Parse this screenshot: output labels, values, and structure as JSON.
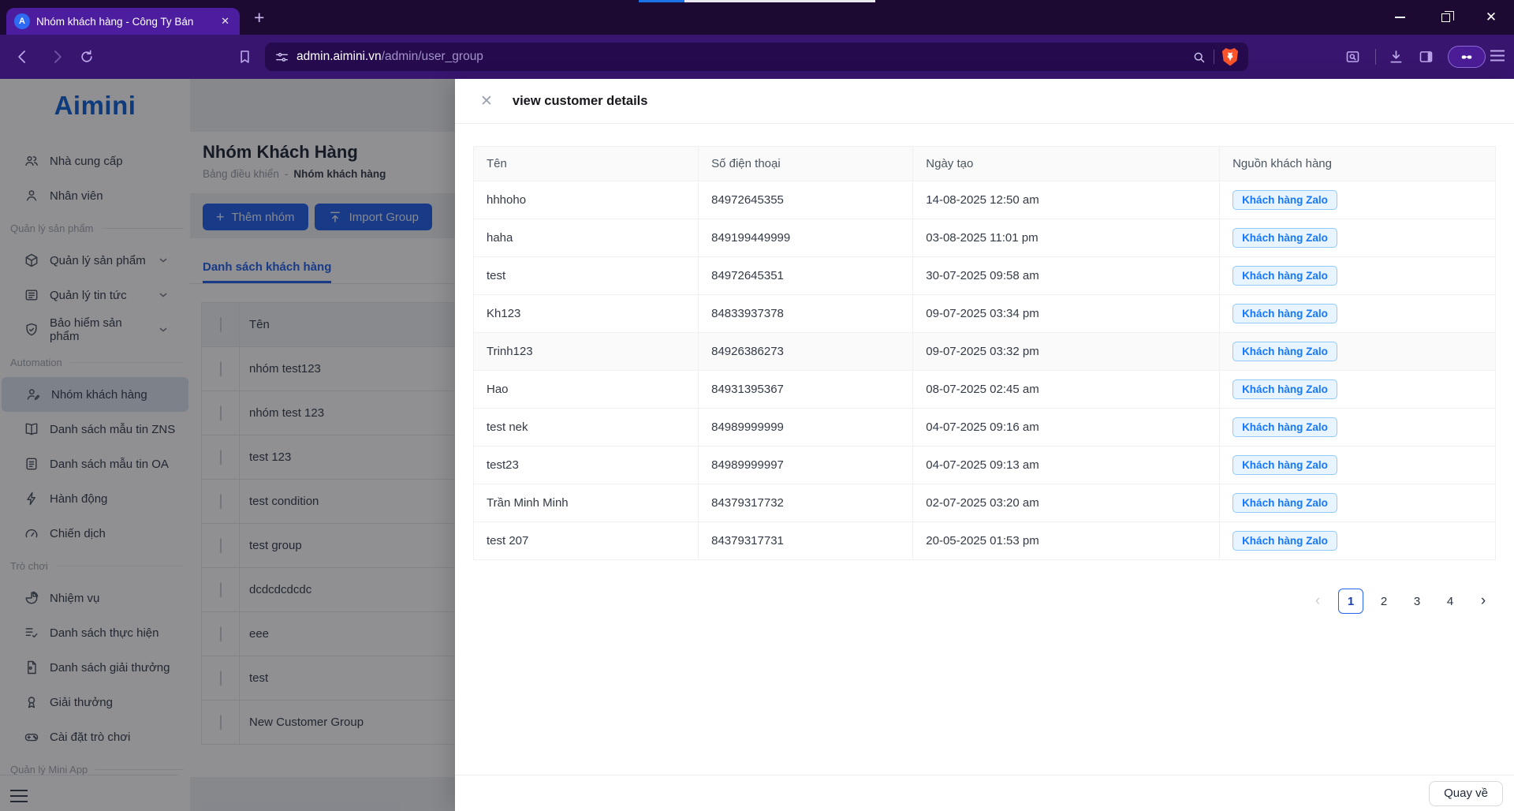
{
  "browser": {
    "tab": {
      "title": "Nhóm khách hàng - Công Ty Bán",
      "favicon_letter": "A"
    },
    "url": {
      "host": "admin.aimini.vn",
      "path": "/admin/user_group"
    }
  },
  "sidebar": {
    "logo": "Aimini",
    "nav": [
      {
        "kind": "item",
        "icon": "users",
        "label": "Nhà cung cấp"
      },
      {
        "kind": "item",
        "icon": "user",
        "label": "Nhân viên"
      },
      {
        "kind": "section",
        "label": "Quản lý sản phẩm"
      },
      {
        "kind": "item",
        "icon": "cube",
        "label": "Quản lý sản phẩm",
        "chevron": true
      },
      {
        "kind": "item",
        "icon": "news",
        "label": "Quản lý tin tức",
        "chevron": true
      },
      {
        "kind": "item",
        "icon": "shield",
        "label": "Bảo hiểm sản phẩm",
        "chevron": true
      },
      {
        "kind": "section",
        "label": "Automation"
      },
      {
        "kind": "item",
        "icon": "user-pen",
        "label": "Nhóm khách hàng",
        "active": true
      },
      {
        "kind": "item",
        "icon": "book",
        "label": "Danh sách mẫu tin ZNS"
      },
      {
        "kind": "item",
        "icon": "doc",
        "label": "Danh sách mẫu tin OA"
      },
      {
        "kind": "item",
        "icon": "bolt",
        "label": "Hành động"
      },
      {
        "kind": "item",
        "icon": "gauge",
        "label": "Chiến dịch"
      },
      {
        "kind": "section",
        "label": "Trò chơi"
      },
      {
        "kind": "item",
        "icon": "pie",
        "label": "Nhiệm vụ"
      },
      {
        "kind": "item",
        "icon": "list",
        "label": "Danh sách thực hiện"
      },
      {
        "kind": "item",
        "icon": "file",
        "label": "Danh sách giải thưởng"
      },
      {
        "kind": "item",
        "icon": "medal",
        "label": "Giải thưởng"
      },
      {
        "kind": "item",
        "icon": "gamepad",
        "label": "Cài đặt trò chơi"
      },
      {
        "kind": "section",
        "label": "Quản lý Mini App"
      }
    ]
  },
  "main": {
    "title": "Nhóm Khách Hàng",
    "breadcrumb": {
      "home": "Bảng điều khiển",
      "sep": "-",
      "current": "Nhóm khách hàng"
    },
    "buttons": {
      "add": "Thêm nhóm",
      "import": "Import Group"
    },
    "tab_label": "Danh sách khách hàng",
    "group_table": {
      "name_header": "Tên",
      "rows": [
        "nhóm test123",
        "nhóm test 123",
        "test 123",
        "test condition",
        "test group",
        "dcdcdcdcdc",
        "eee",
        "test",
        "New Customer Group"
      ]
    }
  },
  "modal": {
    "title": "view customer details",
    "table": {
      "columns": [
        "Tên",
        "Số điện thoại",
        "Ngày tạo",
        "Nguồn khách hàng"
      ],
      "rows": [
        {
          "name": "hhhoho",
          "phone": "84972645355",
          "created": "14-08-2025 12:50 am",
          "source": "Khách hàng Zalo"
        },
        {
          "name": "haha",
          "phone": "849199449999",
          "created": "03-08-2025 11:01 pm",
          "source": "Khách hàng Zalo"
        },
        {
          "name": "test",
          "phone": "84972645351",
          "created": "30-07-2025 09:58 am",
          "source": "Khách hàng Zalo"
        },
        {
          "name": "Kh123",
          "phone": "84833937378",
          "created": "09-07-2025 03:34 pm",
          "source": "Khách hàng Zalo"
        },
        {
          "name": "Trinh123",
          "phone": "84926386273",
          "created": "09-07-2025 03:32 pm",
          "source": "Khách hàng Zalo",
          "hover": true
        },
        {
          "name": "Hao",
          "phone": "84931395367",
          "created": "08-07-2025 02:45 am",
          "source": "Khách hàng Zalo"
        },
        {
          "name": "test nek",
          "phone": "84989999999",
          "created": "04-07-2025 09:16 am",
          "source": "Khách hàng Zalo"
        },
        {
          "name": "test23",
          "phone": "84989999997",
          "created": "04-07-2025 09:13 am",
          "source": "Khách hàng Zalo"
        },
        {
          "name": "Trần Minh Minh",
          "phone": "84379317732",
          "created": "02-07-2025 03:20 am",
          "source": "Khách hàng Zalo"
        },
        {
          "name": "test 207",
          "phone": "84379317731",
          "created": "20-05-2025 01:53 pm",
          "source": "Khách hàng Zalo"
        }
      ]
    },
    "pagination": {
      "prev": "‹",
      "next": "›",
      "pages": [
        "1",
        "2",
        "3",
        "4"
      ],
      "active": "1"
    },
    "back_button": "Quay về"
  },
  "colors": {
    "accent_blue": "#2563eb",
    "badge_bg": "#e8f4ff",
    "badge_border": "#91caff",
    "badge_text": "#1677ff",
    "chrome_dark": "#1c0a33",
    "chrome_tab": "#4c1d9e",
    "chrome_toolbar": "#38156f",
    "urlbar": "#250b4e",
    "brave_orange": "#fb542b",
    "favicon_blue": "#2f6bf2",
    "logo_blue": "#1565d8"
  }
}
